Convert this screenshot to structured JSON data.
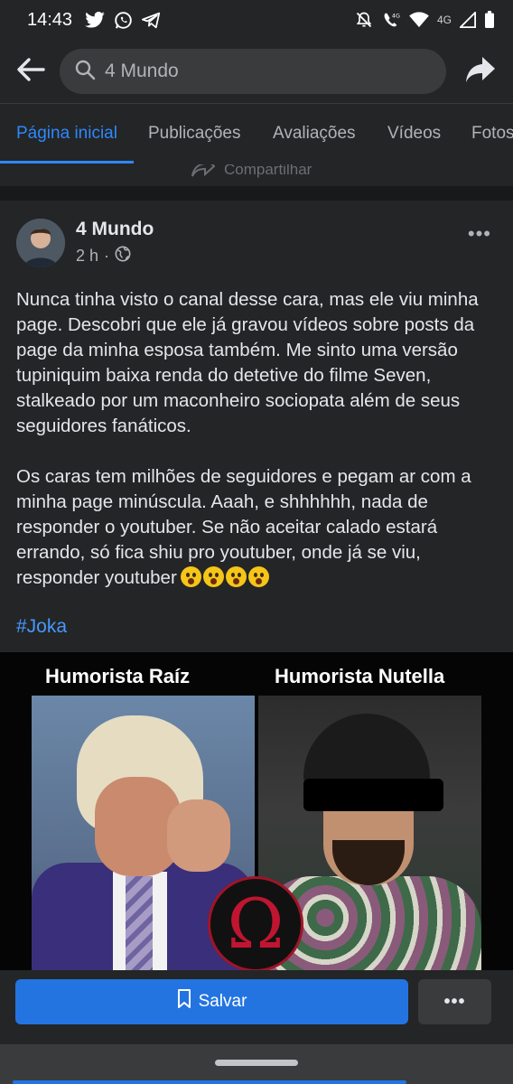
{
  "status_bar": {
    "time": "14:43",
    "network_label": "4G"
  },
  "top_bar": {
    "search_value": "4 Mundo"
  },
  "tabs": [
    {
      "label": "Página inicial",
      "active": true
    },
    {
      "label": "Publicações",
      "active": false
    },
    {
      "label": "Avaliações",
      "active": false
    },
    {
      "label": "Vídeos",
      "active": false
    },
    {
      "label": "Fotos",
      "active": false
    }
  ],
  "previous_post": {
    "share_label": "Compartilhar"
  },
  "post": {
    "page_name": "4 Mundo",
    "time": "2 h",
    "paragraph_1": "Nunca tinha visto o canal desse cara, mas ele viu minha page. Descobri que ele já gravou vídeos sobre posts da page da minha esposa também. Me sinto uma versão tupiniquim baixa renda do detetive do filme Seven, stalkeado por um maconheiro sociopata além de seus seguidores fanáticos.",
    "paragraph_2": "Os caras tem milhões de seguidores e pegam ar com a minha page minúscula. Aaah, e shhhhhh, nada de responder o youtuber. Se não aceitar calado estará errando, só fica shiu pro youtuber, onde já se viu, responder youtuber",
    "hashtag": "#Joka",
    "image": {
      "left_title": "Humorista Raíz",
      "right_title": "Humorista Nutella"
    }
  },
  "actions": {
    "save_label": "Salvar",
    "more_label": "•••"
  },
  "colors": {
    "accent": "#2374e1",
    "link": "#4599ff",
    "background": "#18191a",
    "card": "#242526"
  }
}
